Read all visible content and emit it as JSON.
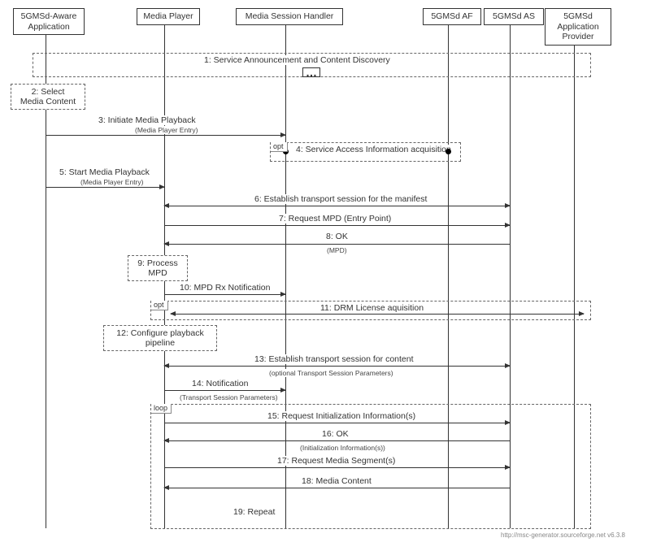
{
  "actors": {
    "a1": "5GMSd-Aware\nApplication",
    "a2": "Media Player",
    "a3": "Media Session Handler",
    "a4": "5GMSd AF",
    "a5": "5GMSd AS",
    "a6": "5GMSd\nApplication\nProvider"
  },
  "messages": {
    "m1": "1: Service Announcement and Content Discovery",
    "m2": "2: Select\nMedia Content",
    "m3": "3: Initiate Media Playback",
    "m3s": "(Media Player Entry)",
    "m4": "4: Service Access Information acquisition",
    "m5": "5: Start Media Playback",
    "m5s": "(Media Player Entry)",
    "m6": "6: Establish transport session for the manifest",
    "m7": "7: Request MPD (Entry Point)",
    "m8": "8: OK",
    "m8s": "(MPD)",
    "m9": "9: Process\nMPD",
    "m10": "10: MPD Rx Notification",
    "m11": "11: DRM License aquisition",
    "m12": "12: Configure playback\npipeline",
    "m13": "13: Establish transport session for content",
    "m13s": "(optional Transport Session Parameters)",
    "m14": "14: Notification",
    "m14s": "(Transport Session Parameters)",
    "m15": "15: Request Initialization Information(s)",
    "m16": "16: OK",
    "m16s": "(Initialization Information(s))",
    "m17": "17: Request Media Segment(s)",
    "m18": "18: Media Content",
    "m19": "19: Repeat"
  },
  "fragments": {
    "opt": "opt",
    "loop": "loop"
  },
  "credit": "http://msc-generator.sourceforge.net v6.3.8"
}
